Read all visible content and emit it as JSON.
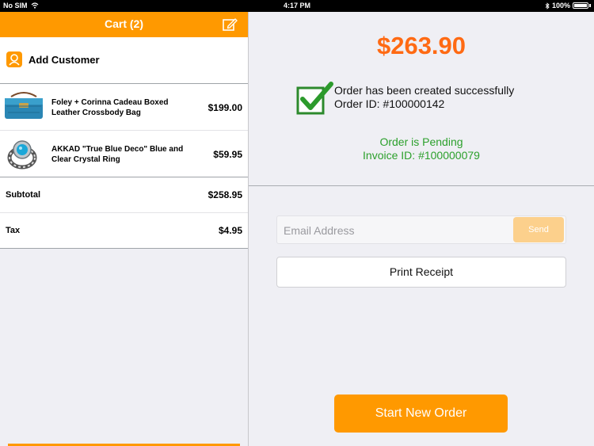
{
  "status_bar": {
    "carrier": "No SIM",
    "time": "4:17 PM",
    "battery": "100%"
  },
  "cart": {
    "title": "Cart (2)",
    "add_customer_label": "Add Customer",
    "items": [
      {
        "name": "Foley + Corinna Cadeau Boxed Leather Crossbody Bag",
        "price": "$199.00"
      },
      {
        "name": "AKKAD \"True Blue Deco\" Blue and Clear Crystal Ring",
        "price": "$59.95"
      }
    ],
    "subtotal_label": "Subtotal",
    "subtotal_value": "$258.95",
    "tax_label": "Tax",
    "tax_value": "$4.95"
  },
  "order": {
    "total": "$263.90",
    "success_message": "Order has been created successfully",
    "order_id": "Order ID: #100000142",
    "status": "Order is Pending",
    "invoice_id": "Invoice ID: #100000079"
  },
  "receipt": {
    "email_placeholder": "Email Address",
    "send_label": "Send",
    "print_label": "Print Receipt"
  },
  "start_new_order_label": "Start New Order",
  "colors": {
    "accent": "#ff9900",
    "total_text": "#ff6a13",
    "success_green": "#2ca02c"
  }
}
